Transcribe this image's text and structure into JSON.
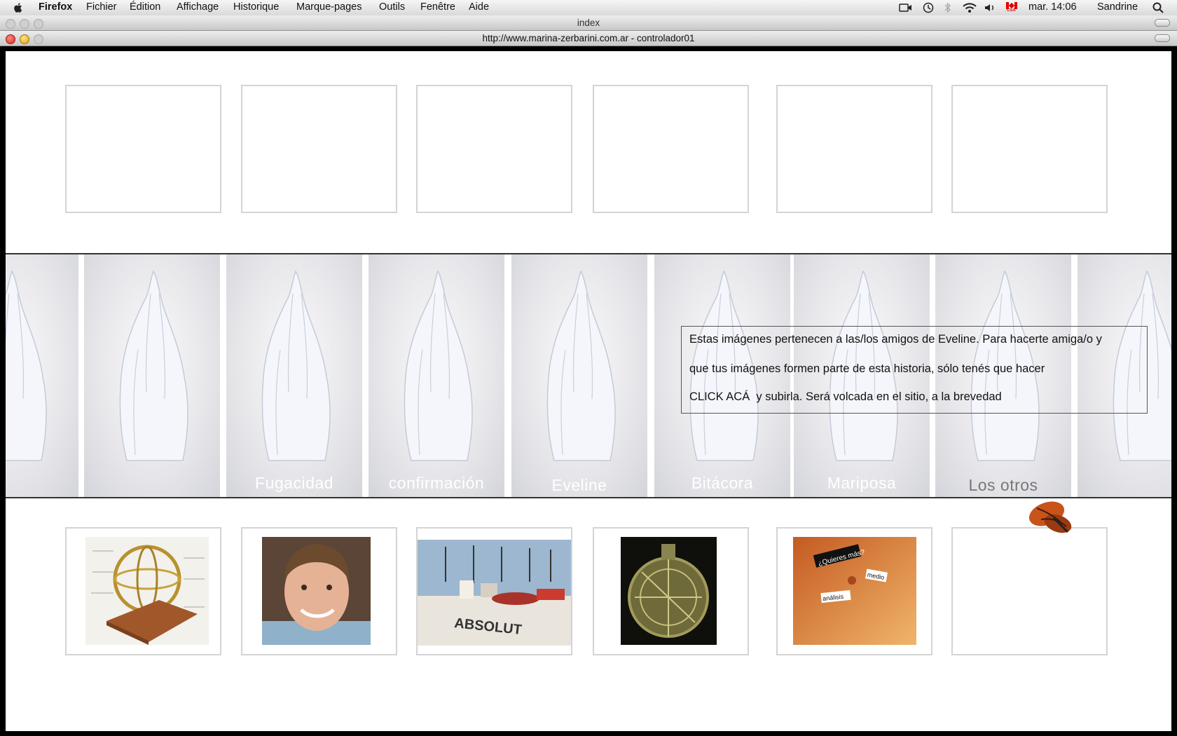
{
  "menubar": {
    "app": "Firefox",
    "items": [
      "Fichier",
      "Édition",
      "Affichage",
      "Historique",
      "Marque-pages",
      "Outils",
      "Fenêtre",
      "Aide"
    ],
    "clock": "mar. 14:06",
    "user": "Sandrine",
    "flag_text": "CSA"
  },
  "window": {
    "outer_title": "index",
    "inner_title": "http://www.marina-zerbarini.com.ar - controlador01"
  },
  "band": {
    "panels": [
      "",
      "",
      "Fugacidad",
      "confirmación",
      "Eveline",
      "Bitácora",
      "Mariposa",
      "Los otros",
      ""
    ]
  },
  "infobox": {
    "line1": "Estas imágenes pertenecen a las/los amigos de Eveline.  Para hacerte amiga/o y",
    "line2": "que tus imágenes  formen parte de esta historia, sólo tenés que hacer",
    "click": "CLICK ACÁ",
    "line3_rest": "  y subirla. Será volcada en el sitio, a la brevedad"
  },
  "thumbnails_bottom": [
    "armillary-sphere",
    "boy-portrait",
    "furniture-showroom",
    "astrolabe",
    "body-with-stickers",
    "empty"
  ],
  "sticker_text": {
    "a": "¿Quieres más?",
    "b": "medio",
    "c": "análisis"
  },
  "showroom_text": "ABSOLUT",
  "colors": {
    "frame_border": "#d4d4d4",
    "band_line": "#333333",
    "label": "#ffffff"
  }
}
